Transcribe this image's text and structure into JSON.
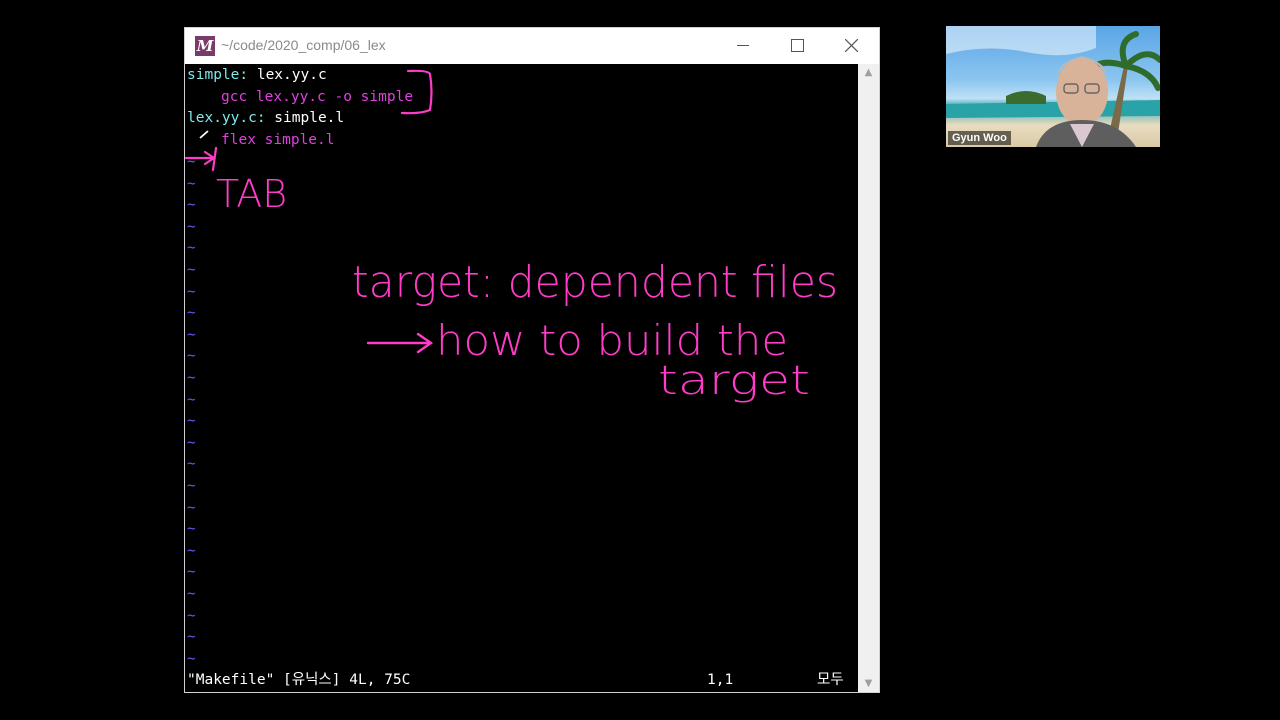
{
  "window": {
    "title": "~/code/2020_comp/06_lex",
    "icon": "vim-M-icon"
  },
  "makefile": {
    "line1": {
      "target": "simple:",
      "deps": " lex.yy.c"
    },
    "line2": {
      "command": "gcc lex.yy.c -o simple"
    },
    "line3": {
      "target": "lex.yy.c:",
      "deps": " simple.l"
    },
    "line4": {
      "command": "flex simple.l"
    },
    "tilde": "~"
  },
  "statusline": {
    "file_info": "\"Makefile\" [유닉스] 4L, 75C",
    "cursor_pos": "1,1",
    "scroll_all": "모두"
  },
  "annotations": {
    "tab_note": "TAB",
    "rule_line1": "target: dependent files",
    "rule_line2": "how to build the",
    "rule_line3": "target"
  },
  "video": {
    "participant_name": "Gyun Woo"
  },
  "colors": {
    "target": "#7fe8e8",
    "command": "#e040e0",
    "tilde": "#6060ff",
    "ink": "#ff3cc8"
  }
}
